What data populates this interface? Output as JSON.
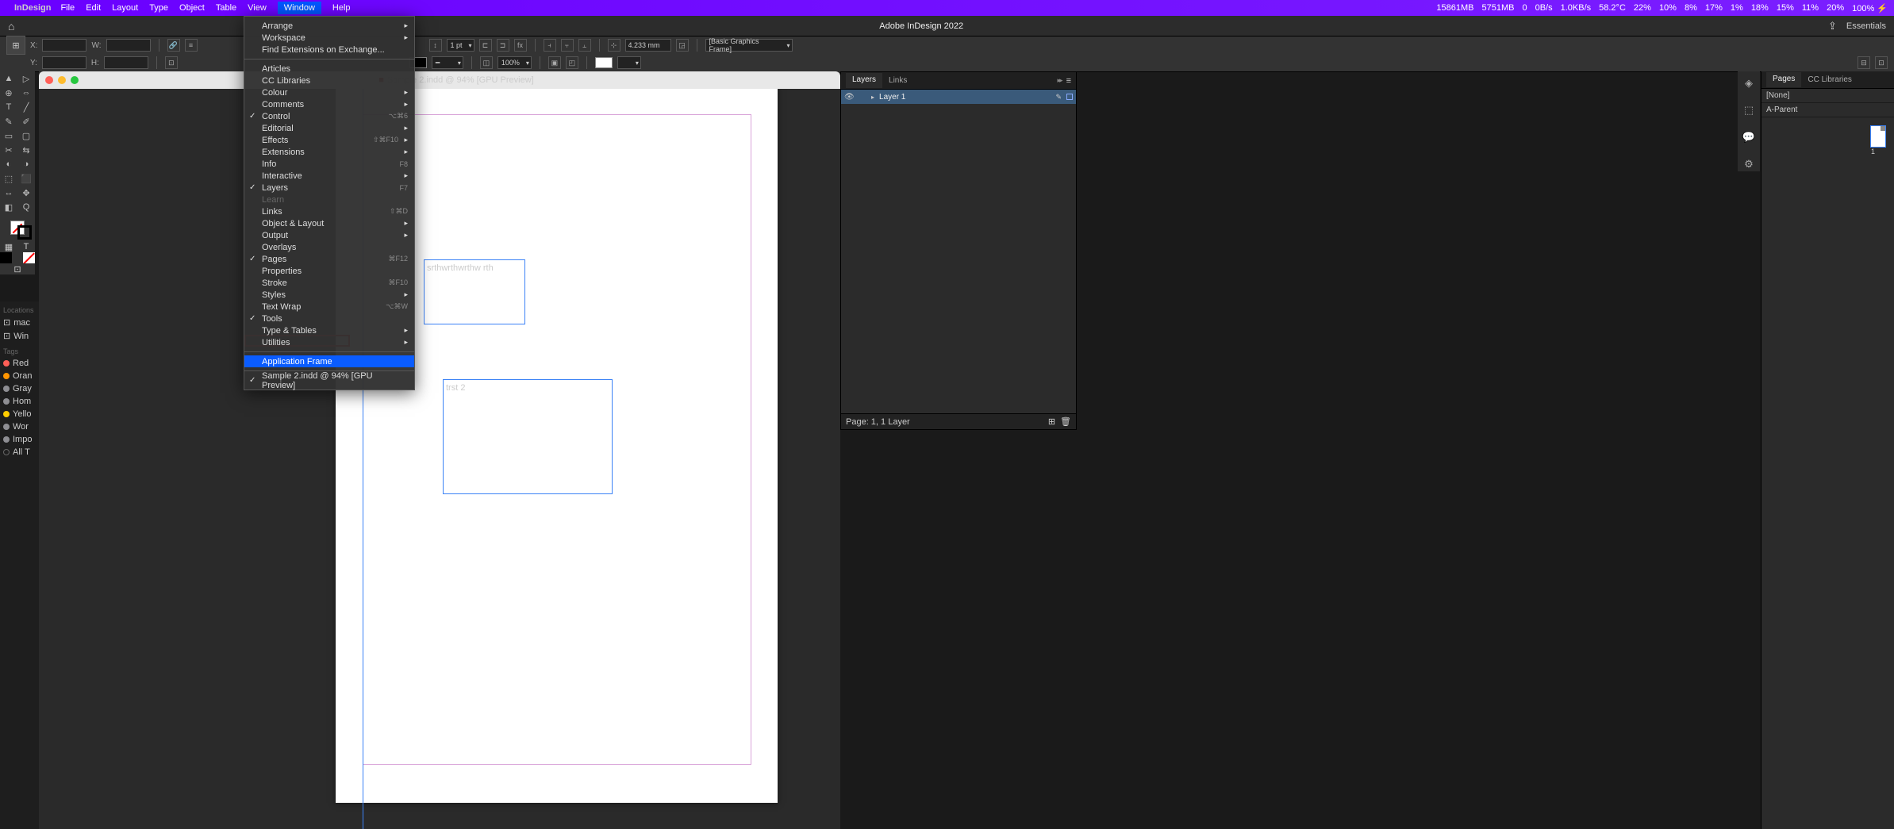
{
  "menubar": {
    "app": "InDesign",
    "items": [
      "File",
      "Edit",
      "Layout",
      "Type",
      "Object",
      "Table",
      "View",
      "Window",
      "Help"
    ],
    "active": "Window",
    "status_right": [
      "15861MB",
      "5751MB",
      "0",
      "0B/s",
      "1.0KB/s",
      "58.2°C",
      "22%",
      "10%",
      "8%",
      "17%",
      "1%",
      "18%",
      "15%",
      "11%",
      "20%",
      "100% ⚡"
    ]
  },
  "appbar": {
    "title": "Adobe InDesign 2022",
    "essentials": "Essentials"
  },
  "controlbar": {
    "x_label": "X:",
    "y_label": "Y:",
    "w_label": "W:",
    "h_label": "H:",
    "stroke_weight": "1 pt",
    "ref_value": "4.233 mm",
    "opacity": "100%",
    "style_dropdown": "[Basic Graphics Frame]"
  },
  "toolbox_tools": [
    "▲",
    "▷",
    "⊕",
    "⇔",
    "T",
    "╱",
    "✎",
    "✐",
    "▭",
    "▢",
    "✂",
    "⇆",
    "◐",
    "◑",
    "⬚",
    "⬛",
    "↔",
    "✥",
    "◧",
    "Q"
  ],
  "toolbox_mode": [
    "▦",
    "T"
  ],
  "left_sidebar": {
    "locations_label": "Locations",
    "locations": [
      {
        "label": "mac"
      },
      {
        "label": "Win"
      }
    ],
    "tags_label": "Tags",
    "tags": [
      {
        "label": "Red",
        "color": "#ff5f57"
      },
      {
        "label": "Oran",
        "color": "#ff9500"
      },
      {
        "label": "Gray",
        "color": "#8e8e93"
      },
      {
        "label": "Hom",
        "color": "#8e8e93"
      },
      {
        "label": "Yello",
        "color": "#ffcc00"
      },
      {
        "label": "Wor",
        "color": "#8e8e93"
      },
      {
        "label": "Impo",
        "color": "#8e8e93"
      },
      {
        "label": "All T",
        "color": ""
      }
    ]
  },
  "document": {
    "tab_title": "Sample 2.indd @ 94% [GPU Preview]",
    "frame1_text": "srthwrthwrthw rth",
    "frame2_text": "trst 2"
  },
  "window_menu": [
    {
      "label": "Arrange",
      "submenu": true
    },
    {
      "label": "Workspace",
      "submenu": true
    },
    {
      "label": "Find Extensions on Exchange..."
    },
    {
      "divider": true
    },
    {
      "label": "Articles"
    },
    {
      "label": "CC Libraries"
    },
    {
      "label": "Colour",
      "submenu": true
    },
    {
      "label": "Comments",
      "submenu": true
    },
    {
      "label": "Control",
      "checked": true,
      "shortcut": "⌥⌘6"
    },
    {
      "label": "Editorial",
      "submenu": true
    },
    {
      "label": "Effects",
      "submenu": true,
      "shortcut": "⇧⌘F10"
    },
    {
      "label": "Extensions",
      "submenu": true
    },
    {
      "label": "Info",
      "shortcut": "F8"
    },
    {
      "label": "Interactive",
      "submenu": true
    },
    {
      "label": "Layers",
      "checked": true,
      "shortcut": "F7"
    },
    {
      "label": "Learn",
      "disabled": true
    },
    {
      "label": "Links",
      "shortcut": "⇧⌘D"
    },
    {
      "label": "Object & Layout",
      "submenu": true
    },
    {
      "label": "Output",
      "submenu": true
    },
    {
      "label": "Overlays"
    },
    {
      "label": "Pages",
      "checked": true,
      "shortcut": "⌘F12"
    },
    {
      "label": "Properties"
    },
    {
      "label": "Stroke",
      "shortcut": "⌘F10"
    },
    {
      "label": "Styles",
      "submenu": true
    },
    {
      "label": "Text Wrap",
      "shortcut": "⌥⌘W"
    },
    {
      "label": "Tools",
      "checked": true
    },
    {
      "label": "Type & Tables",
      "submenu": true
    },
    {
      "label": "Utilities",
      "submenu": true
    },
    {
      "divider": true
    },
    {
      "label": "Application Frame",
      "highlighted": true
    },
    {
      "divider": true
    },
    {
      "label": "Sample 2.indd @ 94% [GPU Preview]",
      "checked": true
    }
  ],
  "layers_panel": {
    "tabs": [
      "Layers",
      "Links"
    ],
    "layer_name": "Layer 1",
    "footer": "Page: 1, 1 Layer"
  },
  "pages_panel": {
    "tabs": [
      "Pages",
      "CC Libraries"
    ],
    "none": "[None]",
    "parent": "A-Parent",
    "page_num": "1"
  },
  "dock_icons": [
    "◈",
    "⬚",
    "💬",
    "⚙"
  ]
}
